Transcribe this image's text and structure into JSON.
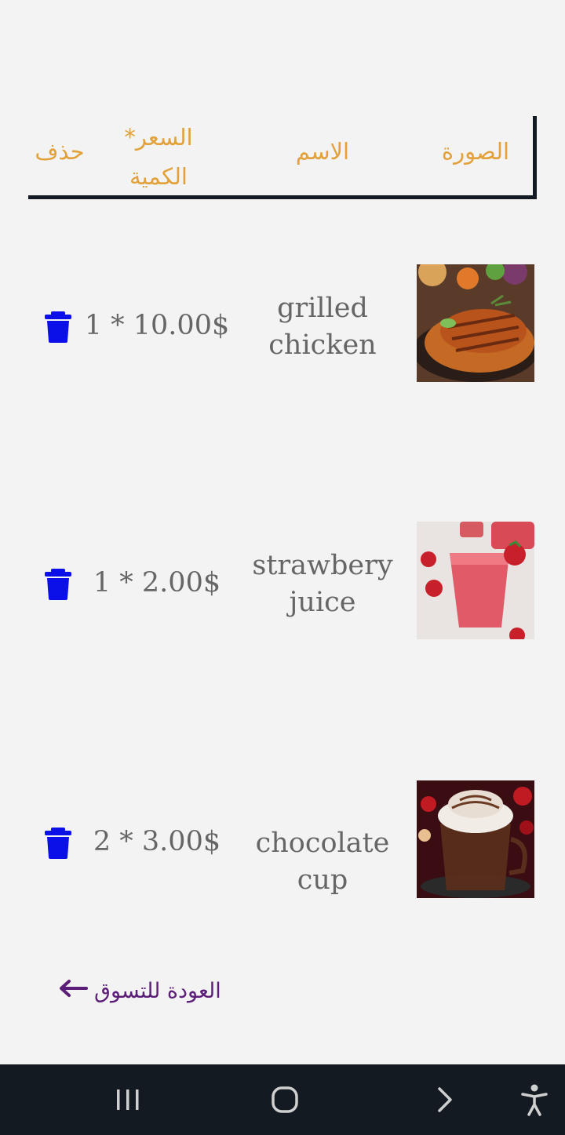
{
  "table": {
    "headers": {
      "image": "الصورة",
      "name": "الاسم",
      "price_qty_line1": "السعر*",
      "price_qty_line2": "الكمية",
      "delete": "حذف"
    }
  },
  "cart": {
    "items": [
      {
        "name_line1": "grilled",
        "name_line2": "chicken",
        "qty_price": "1 * 10.00$",
        "image_icon": "grilled-chicken-photo"
      },
      {
        "name_line1": "strawbery",
        "name_line2": "juice",
        "qty_price": "1 * 2.00$",
        "image_icon": "strawberry-juice-photo"
      },
      {
        "name_line1": "chocolate cup",
        "name_line2": "",
        "qty_price": "2 * 3.00$",
        "image_icon": "chocolate-cup-photo"
      }
    ]
  },
  "back_link": {
    "label": "العودة للتسوق",
    "icon": "arrow-left-icon"
  },
  "system_nav": {
    "buttons": [
      "recent-apps-icon",
      "home-icon",
      "back-icon",
      "accessibility-icon"
    ]
  },
  "colors": {
    "header_text": "#e2a13a",
    "item_text": "#666666",
    "trash": "#0b10e8",
    "back_link": "#5b1d78",
    "navbar": "#141a22",
    "background": "#f3f3f3"
  }
}
